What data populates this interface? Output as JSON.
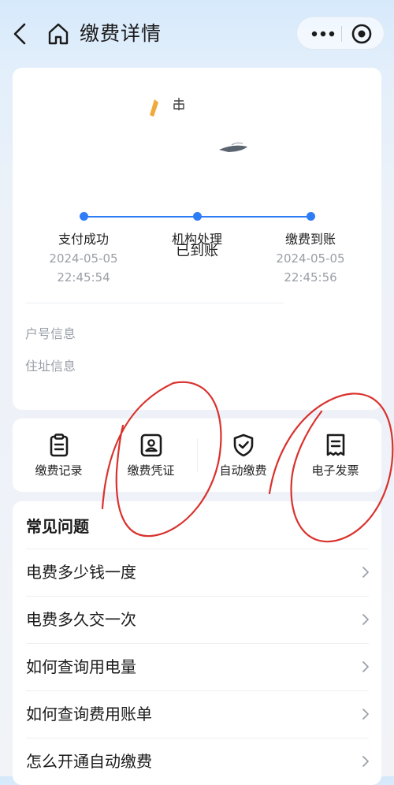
{
  "nav": {
    "title": "缴费详情"
  },
  "status": {
    "text": "已到账",
    "steps": [
      {
        "label": "支付成功",
        "date": "2024-05-05",
        "time": "22:45:54"
      },
      {
        "label": "机构处理",
        "date": "",
        "time": ""
      },
      {
        "label": "缴费到账",
        "date": "2024-05-05",
        "time": "22:45:56"
      }
    ],
    "info_labels": [
      "户号信息",
      "住址信息"
    ]
  },
  "actions": [
    {
      "label": "缴费记录",
      "icon": "clipboard-icon"
    },
    {
      "label": "缴费凭证",
      "icon": "user-badge-icon"
    },
    {
      "label": "自动缴费",
      "icon": "shield-check-icon"
    },
    {
      "label": "电子发票",
      "icon": "receipt-icon"
    }
  ],
  "faq": {
    "title": "常见问题",
    "items": [
      "电费多少钱一度",
      "电费多久交一次",
      "如何查询用电量",
      "如何查询费用账单",
      "怎么开通自动缴费"
    ]
  },
  "colors": {
    "accent": "#2f7df6",
    "annotation": "#d9322e"
  }
}
